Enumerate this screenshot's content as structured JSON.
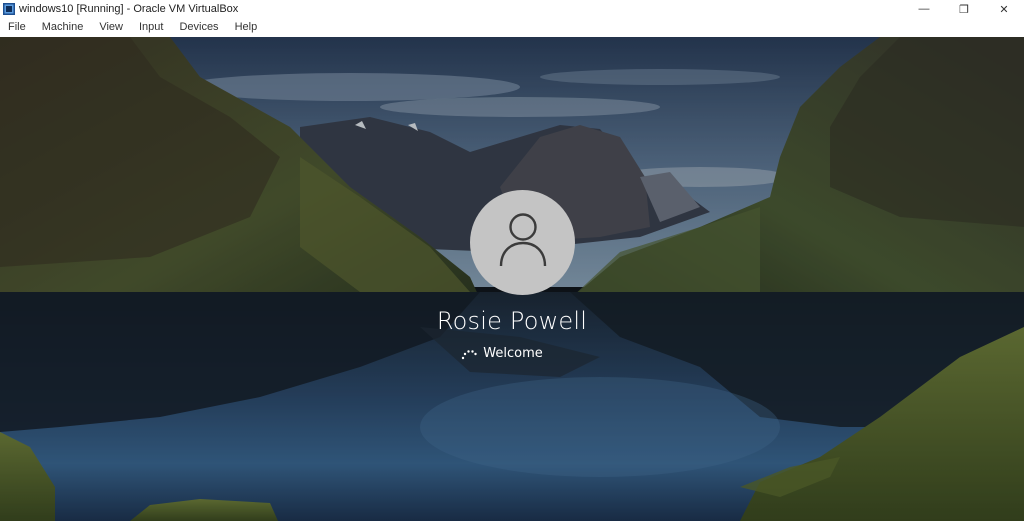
{
  "window": {
    "title": "windows10 [Running] - Oracle VM VirtualBox",
    "app_icon": "virtualbox-icon"
  },
  "menu": {
    "items": [
      "File",
      "Machine",
      "View",
      "Input",
      "Devices",
      "Help"
    ]
  },
  "controls": {
    "minimize": "—",
    "restore": "❐",
    "close": "✕"
  },
  "login": {
    "user_name": "Rosie Powell",
    "status": "Welcome",
    "avatar_icon": "user-silhouette-icon",
    "spinner_icon": "loading-dots-icon"
  },
  "colors": {
    "avatar_bg": "#c4c4c4",
    "text": "#ffffff"
  }
}
